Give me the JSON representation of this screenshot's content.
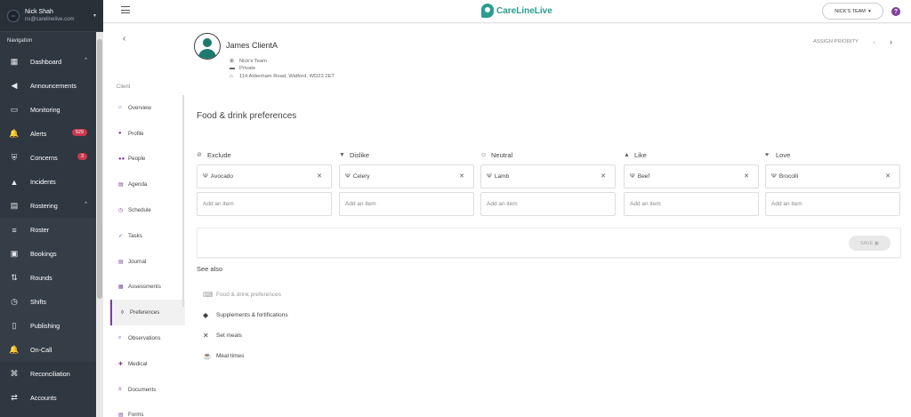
{
  "user": {
    "name": "Nick Shah",
    "email": "ns@carelinelive.com"
  },
  "sidebar": {
    "section_title": "Navigation",
    "items": [
      {
        "label": "Dashboard",
        "icon": "dashboard-icon",
        "glyph": "▦",
        "chevron": "^"
      },
      {
        "label": "Announcements",
        "icon": "megaphone-icon",
        "glyph": "◀"
      },
      {
        "label": "Monitoring",
        "icon": "monitor-icon",
        "glyph": "▭"
      },
      {
        "label": "Alerts",
        "icon": "bell-icon",
        "glyph": "🔔",
        "badge": "529"
      },
      {
        "label": "Concerns",
        "icon": "shield-icon",
        "glyph": "⛨",
        "badge": "3"
      },
      {
        "label": "Incidents",
        "icon": "warning-icon",
        "glyph": "▲"
      },
      {
        "label": "Rostering",
        "icon": "calendar-icon",
        "glyph": "▤",
        "chevron": "^"
      },
      {
        "label": "Roster",
        "icon": "list-icon",
        "glyph": "≡",
        "sub": true
      },
      {
        "label": "Bookings",
        "icon": "booking-icon",
        "glyph": "▣",
        "sub": true
      },
      {
        "label": "Rounds",
        "icon": "rounds-icon",
        "glyph": "⇅",
        "sub": true
      },
      {
        "label": "Shifts",
        "icon": "clock-icon",
        "glyph": "◷",
        "sub": true
      },
      {
        "label": "Publishing",
        "icon": "publish-icon",
        "glyph": "▯",
        "sub": true
      },
      {
        "label": "On-Call",
        "icon": "oncall-icon",
        "glyph": "🔔",
        "sub": true
      },
      {
        "label": "Reconciliation",
        "icon": "command-icon",
        "glyph": "⌘"
      },
      {
        "label": "Accounts",
        "icon": "accounts-icon",
        "glyph": "⇄"
      }
    ]
  },
  "header": {
    "brand": "CareLineLive",
    "team_label": "NICK'S TEAM",
    "help_glyph": "?"
  },
  "client": {
    "name": "James ClientA",
    "team": "Nick's Team",
    "type": "Private",
    "address": "114 Aldenham Road, Watford, WD23 2ET",
    "assign_label": "ASSIGN PRIORITY"
  },
  "client_nav": {
    "title": "Client",
    "items": [
      {
        "label": "Overview",
        "icon": "home-icon",
        "glyph": "⌂"
      },
      {
        "label": "Profile",
        "icon": "person-icon",
        "glyph": "●"
      },
      {
        "label": "People",
        "icon": "people-icon",
        "glyph": "●●"
      },
      {
        "label": "Agenda",
        "icon": "agenda-icon",
        "glyph": "▤"
      },
      {
        "label": "Schedule",
        "icon": "schedule-icon",
        "glyph": "◷"
      },
      {
        "label": "Tasks",
        "icon": "tasks-icon",
        "glyph": "✓"
      },
      {
        "label": "Journal",
        "icon": "journal-icon",
        "glyph": "▤"
      },
      {
        "label": "Assessments",
        "icon": "assessments-icon",
        "glyph": "▦"
      },
      {
        "label": "Preferences",
        "icon": "preferences-icon",
        "glyph": "⚱",
        "active": true
      },
      {
        "label": "Observations",
        "icon": "magnifier-icon",
        "glyph": "⌕"
      },
      {
        "label": "Medical",
        "icon": "medical-icon",
        "glyph": "✚"
      },
      {
        "label": "Documents",
        "icon": "documents-icon",
        "glyph": "≡"
      },
      {
        "label": "Forms",
        "icon": "forms-icon",
        "glyph": "▤"
      }
    ]
  },
  "preferences": {
    "title": "Food & drink preferences",
    "columns": [
      {
        "heading": "Exclude",
        "icon": "ban-icon",
        "glyph": "⊘",
        "item": "Avocado",
        "add_placeholder": "Add an item"
      },
      {
        "heading": "Dislike",
        "icon": "thumbs-down-icon",
        "glyph": "▼",
        "item": "Celery",
        "add_placeholder": "Add an item"
      },
      {
        "heading": "Neutral",
        "icon": "neutral-face-icon",
        "glyph": "☺",
        "item": "Lamb",
        "add_placeholder": "Add an item"
      },
      {
        "heading": "Like",
        "icon": "thumbs-up-icon",
        "glyph": "▲",
        "item": "Beef",
        "add_placeholder": "Add an item"
      },
      {
        "heading": "Love",
        "icon": "heart-icon",
        "glyph": "♥",
        "item": "Brocolli",
        "add_placeholder": "Add an item"
      }
    ],
    "save_label": "SAVE"
  },
  "see_also": {
    "title": "See also",
    "items": [
      {
        "label": "Food & drink preferences",
        "icon": "food-drink-icon",
        "glyph": "⌨",
        "dim": true
      },
      {
        "label": "Supplements & fortifications",
        "icon": "pill-icon",
        "glyph": "◆"
      },
      {
        "label": "Set meals",
        "icon": "cutlery-icon",
        "glyph": "✕"
      },
      {
        "label": "Meal times",
        "icon": "coffee-icon",
        "glyph": "☕"
      }
    ]
  }
}
